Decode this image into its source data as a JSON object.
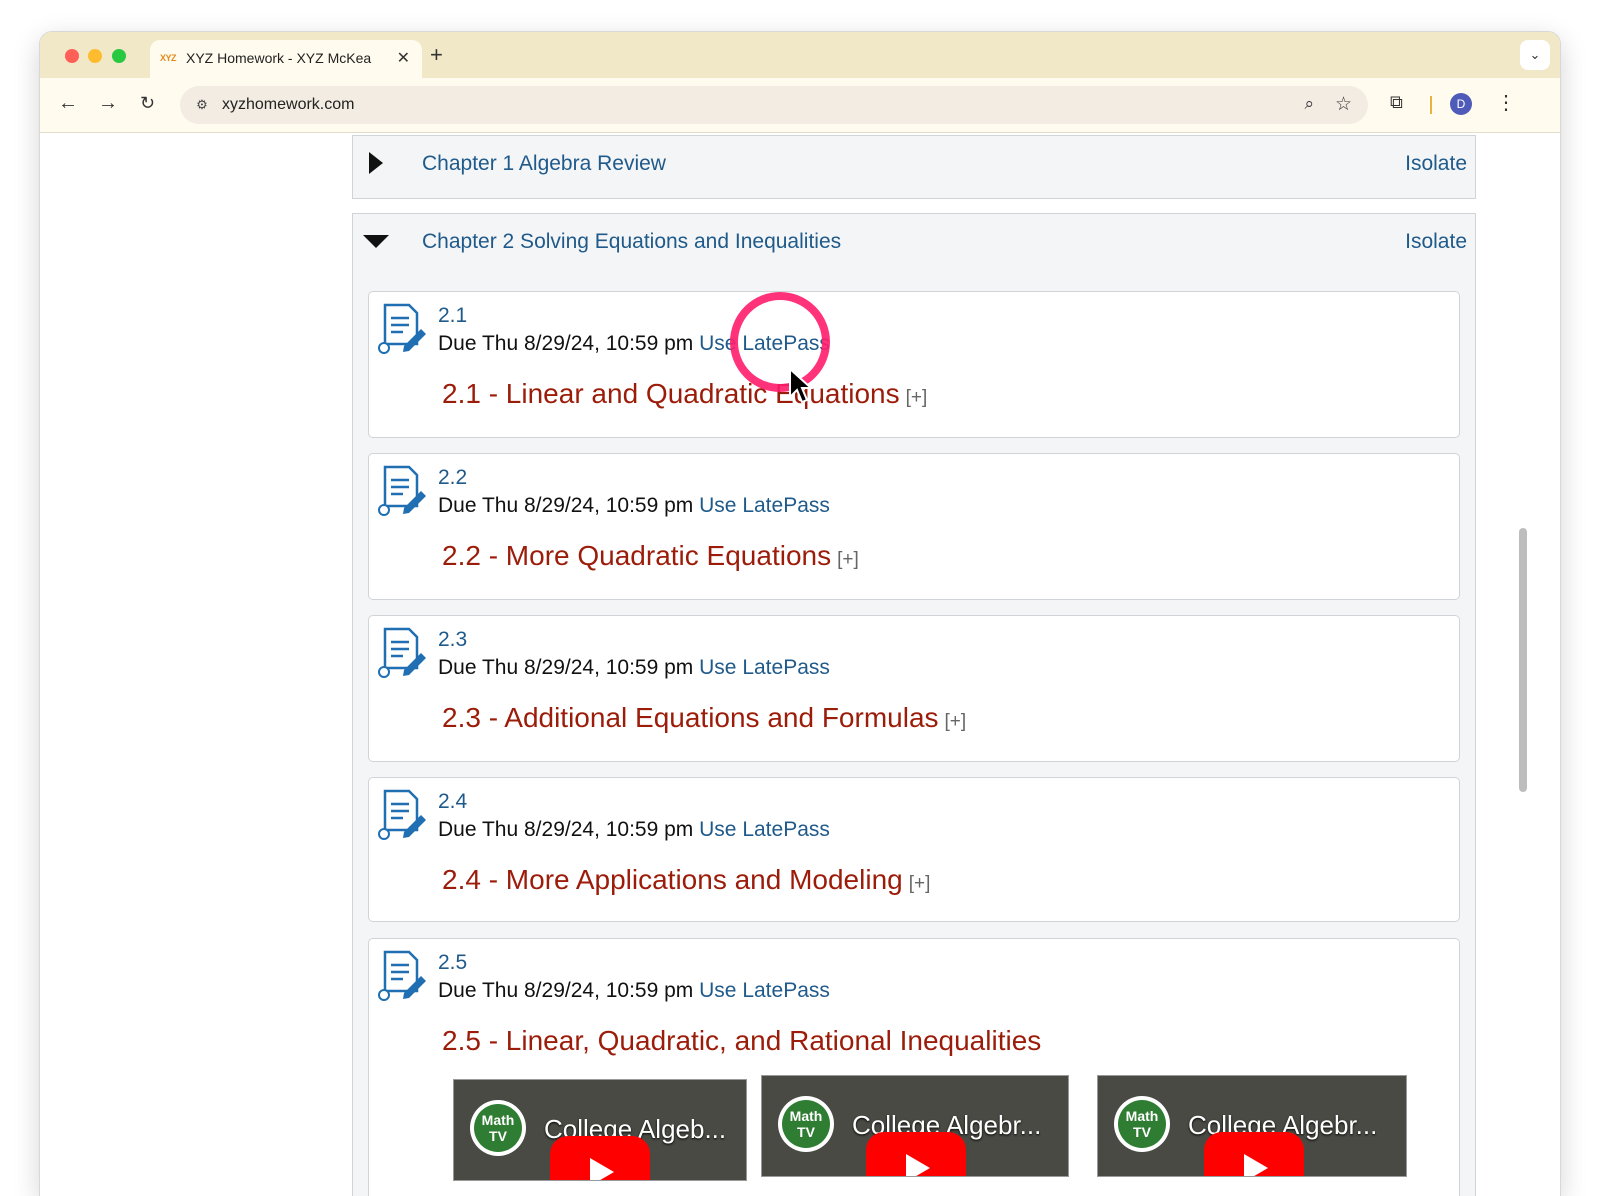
{
  "browser": {
    "tab": {
      "favicon": "XYZ",
      "title": "XYZ Homework - XYZ McKea",
      "close": "✕"
    },
    "new_tab": "+",
    "tab_menu": "⌄",
    "url": "xyzhomework.com",
    "avatar": "D"
  },
  "chapters": [
    {
      "title": "Chapter 1 Algebra Review",
      "isolate": "Isolate",
      "expanded": false
    },
    {
      "title": "Chapter 2 Solving Equations and Inequalities",
      "isolate": "Isolate",
      "expanded": true
    }
  ],
  "assignments": [
    {
      "number": "2.1",
      "due": "Due Thu 8/29/24, 10:59 pm",
      "latepass": "Use LatePass",
      "title": "2.1 - Linear and Quadratic Equations",
      "expand": "[+]"
    },
    {
      "number": "2.2",
      "due": "Due Thu 8/29/24, 10:59 pm",
      "latepass": "Use LatePass",
      "title": "2.2 - More Quadratic Equations",
      "expand": "[+]"
    },
    {
      "number": "2.3",
      "due": "Due Thu 8/29/24, 10:59 pm",
      "latepass": "Use LatePass",
      "title": "2.3 - Additional Equations and Formulas",
      "expand": "[+]"
    },
    {
      "number": "2.4",
      "due": "Due Thu 8/29/24, 10:59 pm",
      "latepass": "Use LatePass",
      "title": "2.4 - More Applications and Modeling",
      "expand": "[+]"
    },
    {
      "number": "2.5",
      "due": "Due Thu 8/29/24, 10:59 pm",
      "latepass": "Use LatePass",
      "title": "2.5 - Linear, Quadratic, and Rational Inequalities"
    }
  ],
  "videos": [
    {
      "logo": "Math TV",
      "title": "College Algeb..."
    },
    {
      "logo": "Math TV",
      "title": "College Algebr..."
    },
    {
      "logo": "Math TV",
      "title": "College Algebr..."
    }
  ],
  "colors": {
    "link": "#1f5a8a",
    "assignment_title": "#9c1c0a",
    "click_indicator": "#ff1c6b",
    "tabbar": "#f1e8c7"
  }
}
